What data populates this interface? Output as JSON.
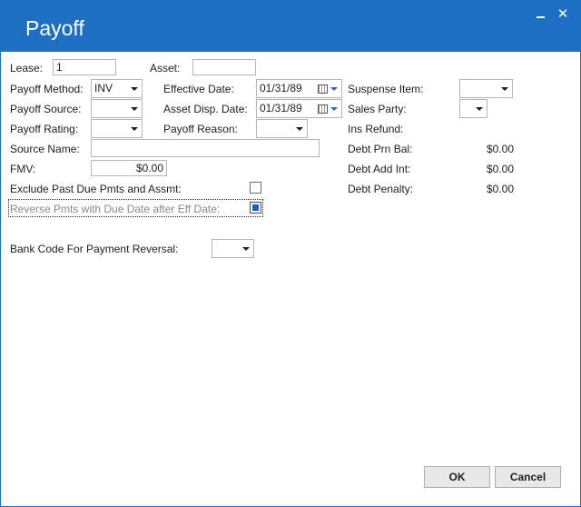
{
  "window": {
    "title": "Payoff",
    "minimize_icon": "minimize-icon",
    "close_icon": "close-icon",
    "close_glyph": "✕"
  },
  "form": {
    "lease": {
      "label": "Lease:",
      "value": "1"
    },
    "asset": {
      "label": "Asset:",
      "value": ""
    },
    "payoff_method": {
      "label": "Payoff Method:",
      "value": "INV"
    },
    "effective_date": {
      "label": "Effective Date:",
      "value": "01/31/89"
    },
    "suspense_item": {
      "label": "Suspense Item:",
      "value": ""
    },
    "payoff_source": {
      "label": "Payoff Source:",
      "value": ""
    },
    "asset_disp_date": {
      "label": "Asset Disp. Date:",
      "value": "01/31/89"
    },
    "sales_party": {
      "label": "Sales Party:",
      "value": ""
    },
    "payoff_rating": {
      "label": "Payoff Rating:",
      "value": ""
    },
    "payoff_reason": {
      "label": "Payoff Reason:",
      "value": ""
    },
    "ins_refund": {
      "label": "Ins Refund:"
    },
    "source_name": {
      "label": "Source Name:",
      "value": ""
    },
    "debt_prn_bal": {
      "label": "Debt Prn Bal:",
      "value": "$0.00"
    },
    "fmv": {
      "label": "FMV:",
      "value": "$0.00"
    },
    "debt_add_int": {
      "label": "Debt Add Int:",
      "value": "$0.00"
    },
    "exclude_past_due": {
      "label": "Exclude Past Due Pmts and Assmt:",
      "checked": false
    },
    "debt_penalty": {
      "label": "Debt Penalty:",
      "value": "$0.00"
    },
    "reverse_pmts": {
      "label": "Reverse Pmts with Due Date after Eff Date:",
      "checked": true,
      "disabled": true
    },
    "bank_code": {
      "label": "Bank Code For Payment Reversal:",
      "value": ""
    }
  },
  "buttons": {
    "ok": "OK",
    "cancel": "Cancel"
  },
  "colors": {
    "titlebar": "#1d6fc1",
    "checkbox_fill": "#1d5fa8"
  }
}
